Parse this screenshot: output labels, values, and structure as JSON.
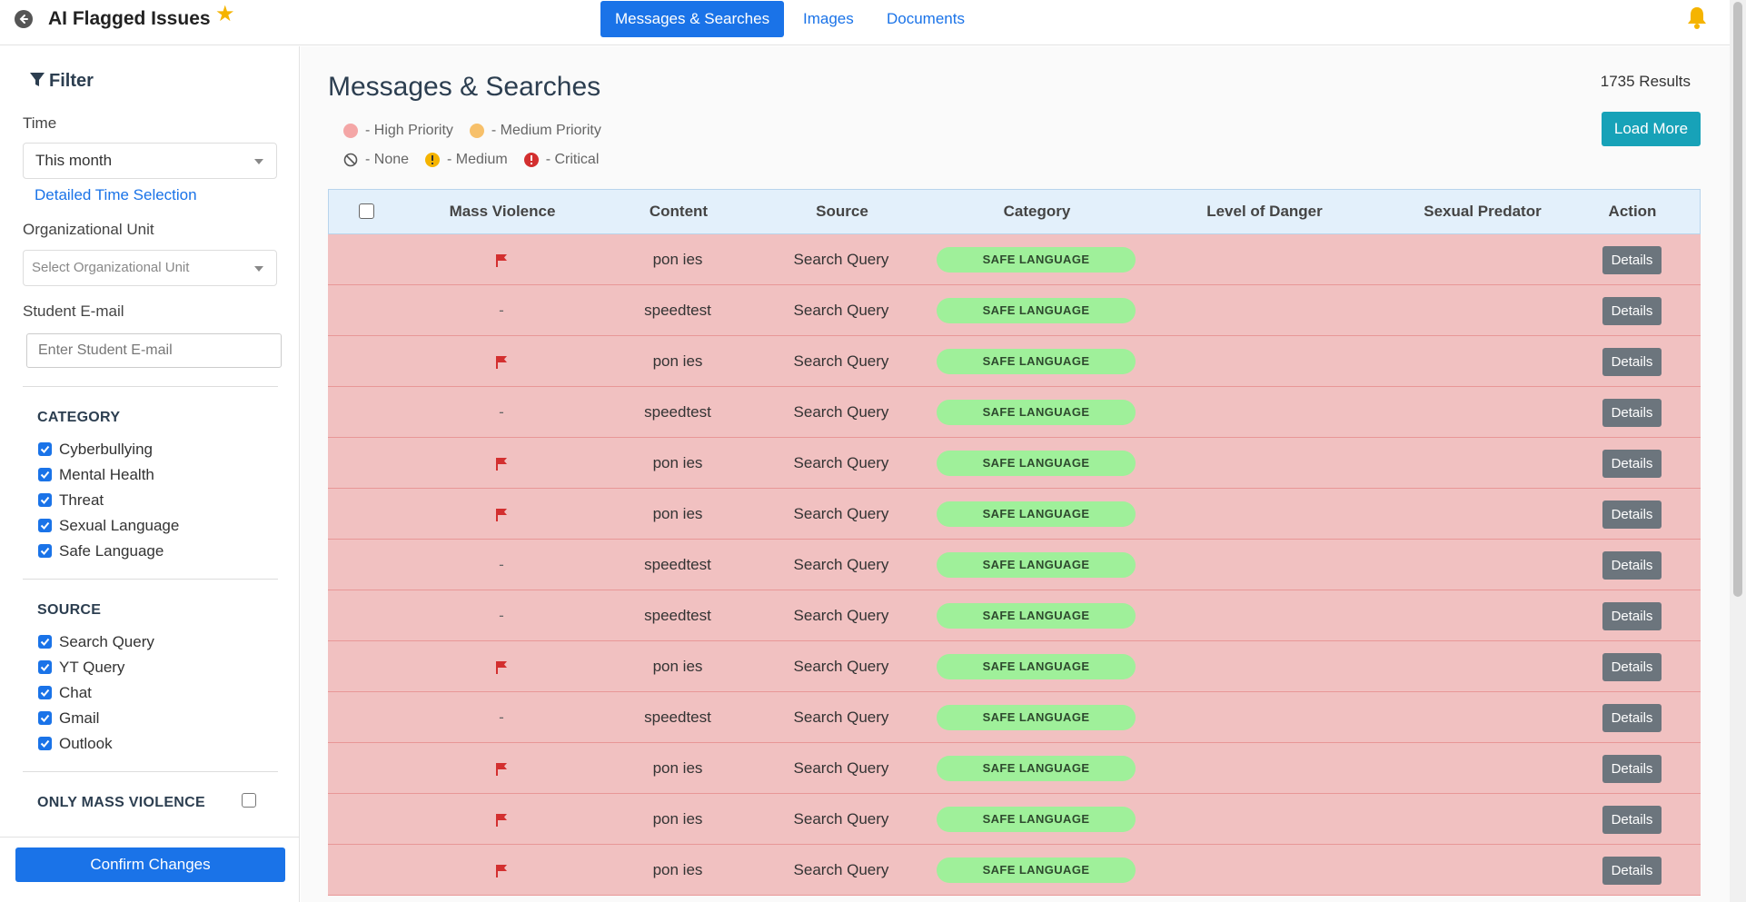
{
  "header": {
    "title": "AI Flagged Issues",
    "tabs": [
      {
        "label": "Messages & Searches",
        "active": true
      },
      {
        "label": "Images",
        "active": false
      },
      {
        "label": "Documents",
        "active": false
      }
    ]
  },
  "sidebar": {
    "filter_title": "Filter",
    "time_label": "Time",
    "time_value": "This month",
    "detailed_time_link": "Detailed Time Selection",
    "org_unit_label": "Organizational Unit",
    "org_unit_placeholder": "Select Organizational Unit",
    "email_label": "Student E-mail",
    "email_placeholder": "Enter Student E-mail",
    "category_title": "CATEGORY",
    "categories": [
      "Cyberbullying",
      "Mental Health",
      "Threat",
      "Sexual Language",
      "Safe Language"
    ],
    "source_title": "SOURCE",
    "sources": [
      "Search Query",
      "YT Query",
      "Chat",
      "Gmail",
      "Outlook"
    ],
    "mass_violence_label": "ONLY MASS VIOLENCE",
    "confirm_label": "Confirm Changes"
  },
  "main": {
    "title": "Messages & Searches",
    "results": "1735 Results",
    "load_more": "Load More",
    "legend": {
      "high": "- High Priority",
      "medium_priority": "- Medium Priority",
      "none": "- None",
      "medium": "- Medium",
      "critical": "- Critical"
    },
    "colors": {
      "high": "#f4a6a6",
      "medium_priority": "#f7c06a",
      "medium_icon": "#f5b400",
      "critical_icon": "#d32f2f",
      "row_bg": "#f1c1c1"
    },
    "columns": [
      "Mass Violence",
      "Content",
      "Source",
      "Category",
      "Level of Danger",
      "Sexual Predator",
      "Action"
    ],
    "rows": [
      {
        "flag": true,
        "dash": "",
        "content": "pon ies",
        "source": "Search Query",
        "category": "SAFE LANGUAGE",
        "action": "Details"
      },
      {
        "flag": false,
        "dash": "-",
        "content": "speedtest",
        "source": "Search Query",
        "category": "SAFE LANGUAGE",
        "action": "Details"
      },
      {
        "flag": true,
        "dash": "",
        "content": "pon ies",
        "source": "Search Query",
        "category": "SAFE LANGUAGE",
        "action": "Details"
      },
      {
        "flag": false,
        "dash": "-",
        "content": "speedtest",
        "source": "Search Query",
        "category": "SAFE LANGUAGE",
        "action": "Details"
      },
      {
        "flag": true,
        "dash": "",
        "content": "pon ies",
        "source": "Search Query",
        "category": "SAFE LANGUAGE",
        "action": "Details"
      },
      {
        "flag": true,
        "dash": "",
        "content": "pon ies",
        "source": "Search Query",
        "category": "SAFE LANGUAGE",
        "action": "Details"
      },
      {
        "flag": false,
        "dash": "-",
        "content": "speedtest",
        "source": "Search Query",
        "category": "SAFE LANGUAGE",
        "action": "Details"
      },
      {
        "flag": false,
        "dash": "-",
        "content": "speedtest",
        "source": "Search Query",
        "category": "SAFE LANGUAGE",
        "action": "Details"
      },
      {
        "flag": true,
        "dash": "",
        "content": "pon ies",
        "source": "Search Query",
        "category": "SAFE LANGUAGE",
        "action": "Details"
      },
      {
        "flag": false,
        "dash": "-",
        "content": "speedtest",
        "source": "Search Query",
        "category": "SAFE LANGUAGE",
        "action": "Details"
      },
      {
        "flag": true,
        "dash": "",
        "content": "pon ies",
        "source": "Search Query",
        "category": "SAFE LANGUAGE",
        "action": "Details"
      },
      {
        "flag": true,
        "dash": "",
        "content": "pon ies",
        "source": "Search Query",
        "category": "SAFE LANGUAGE",
        "action": "Details"
      },
      {
        "flag": true,
        "dash": "",
        "content": "pon ies",
        "source": "Search Query",
        "category": "SAFE LANGUAGE",
        "action": "Details"
      }
    ]
  }
}
